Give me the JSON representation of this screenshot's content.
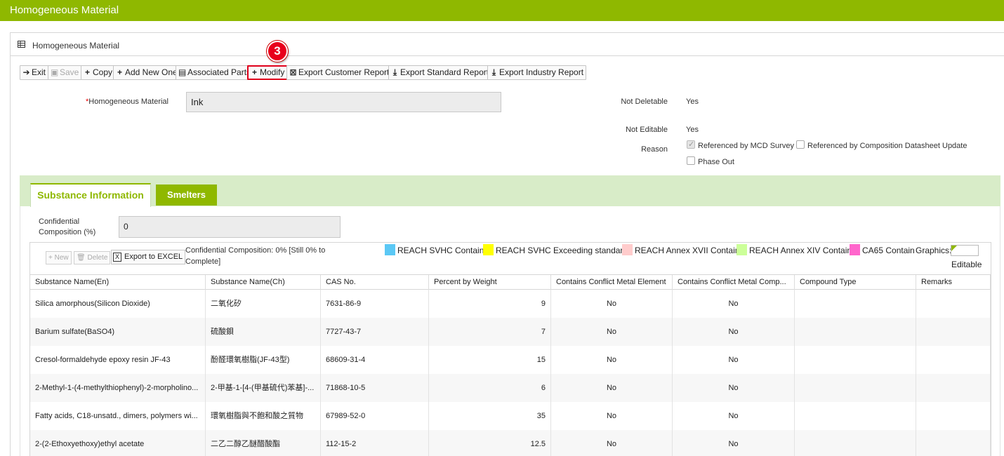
{
  "app": {
    "title": "Homogeneous Material"
  },
  "panel": {
    "title": "Homogeneous Material"
  },
  "toolbar": {
    "exit": "Exit",
    "save": "Save",
    "copy": "Copy",
    "add_new_one": "Add New One",
    "associated_parts": "Associated Parts",
    "modify": "Modify",
    "export_customer": "Export Customer Report",
    "export_standard": "Export Standard Report",
    "export_industry": "Export Industry Report"
  },
  "step_badge": "3",
  "form": {
    "hm_label": "Homogeneous Material",
    "hm_value": "Ink",
    "not_deletable_label": "Not Deletable",
    "not_deletable_value": "Yes",
    "not_editable_label": "Not Editable",
    "not_editable_value": "Yes",
    "reason_label": "Reason",
    "reason_options": [
      {
        "label": "Referenced by MCD Survey",
        "checked": true
      },
      {
        "label": "Referenced by Composition Datasheet Update",
        "checked": false
      },
      {
        "label": "Phase Out",
        "checked": false
      }
    ]
  },
  "tabs": {
    "active": "Substance Information",
    "other": "Smelters"
  },
  "confidential": {
    "label_line1": "Confidential",
    "label_line2": "Composition (%)",
    "value": "0"
  },
  "grid_toolbar": {
    "new": "New",
    "delete": "Delete",
    "export_excel": "Export to EXCEL",
    "status_line1": "Confidential Composition: 0% [Still 0% to",
    "status_line2": "Complete]"
  },
  "legend": [
    {
      "label": "REACH SVHC Contain",
      "color": "#5bc8f5"
    },
    {
      "label": "REACH SVHC Exceeding standard",
      "color": "#ffff00"
    },
    {
      "label": "REACH Annex XVII Contain",
      "color": "#ffcccc"
    },
    {
      "label": "REACH Annex XIV Contain",
      "color": "#ccff99"
    },
    {
      "label": "CA65 Contain",
      "color": "#ff66cc"
    }
  ],
  "graphics": {
    "label": "Graphics:",
    "editable": "Editable"
  },
  "table": {
    "columns": [
      "Substance Name(En)",
      "Substance Name(Ch)",
      "CAS No.",
      "Percent by Weight",
      "Contains Conflict Metal Element",
      "Contains Conflict Metal Comp...",
      "Compound Type",
      "Remarks"
    ],
    "rows": [
      [
        "Silica amorphous(Silicon Dioxide)",
        "二氧化矽",
        "7631-86-9",
        "9",
        "No",
        "No",
        "",
        ""
      ],
      [
        "Barium sulfate(BaSO4)",
        "硫酸鋇",
        "7727-43-7",
        "7",
        "No",
        "No",
        "",
        ""
      ],
      [
        "Cresol-formaldehyde epoxy resin JF-43",
        "酚醛環氧樹脂(JF-43型)",
        "68609-31-4",
        "15",
        "No",
        "No",
        "",
        ""
      ],
      [
        "2-Methyl-1-(4-methylthiophenyl)-2-morpholino...",
        "2-甲基-1-[4-(甲基硫代)苯基]-...",
        "71868-10-5",
        "6",
        "No",
        "No",
        "",
        ""
      ],
      [
        "Fatty acids, C18-unsatd., dimers, polymers wi...",
        "環氧樹脂與不飽和酸之質物",
        "67989-52-0",
        "35",
        "No",
        "No",
        "",
        ""
      ],
      [
        "2-(2-Ethoxyethoxy)ethyl acetate",
        "二乙二醇乙醚醋酸酯",
        "112-15-2",
        "12.5",
        "No",
        "No",
        "",
        ""
      ]
    ]
  }
}
